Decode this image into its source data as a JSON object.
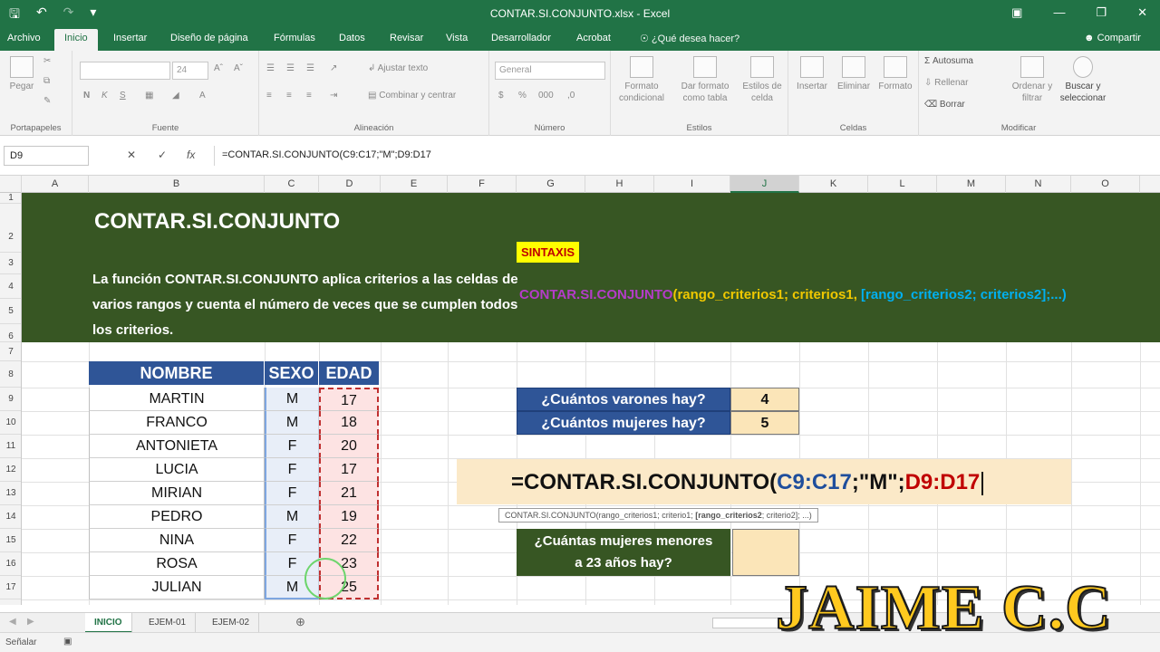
{
  "app": {
    "window_title": "CONTAR.SI.CONJUNTO.xlsx - Excel",
    "tabs": [
      "Archivo",
      "Inicio",
      "Insertar",
      "Diseño de página",
      "Fórmulas",
      "Datos",
      "Revisar",
      "Vista",
      "Desarrollador",
      "Acrobat"
    ],
    "tell_me": "¿Qué desea hacer?",
    "share": "Compartir"
  },
  "ribbon": {
    "portapapeles": {
      "paste": "Pegar",
      "label": "Portapapeles"
    },
    "fuente": {
      "font_size": "24",
      "bold": "N",
      "italic": "K",
      "underline": "S",
      "label": "Fuente"
    },
    "alineacion": {
      "wrap": "Ajustar texto",
      "merge": "Combinar y centrar",
      "label": "Alineación"
    },
    "numero": {
      "format": "General",
      "label": "Número"
    },
    "estilos": {
      "cond": "Formato condicional",
      "table": "Dar formato como tabla",
      "cell": "Estilos de celda",
      "label": "Estilos"
    },
    "celdas": {
      "insert": "Insertar",
      "delete": "Eliminar",
      "format": "Formato",
      "label": "Celdas"
    },
    "modificar": {
      "autosum": "Autosuma",
      "fill": "Rellenar",
      "clear": "Borrar",
      "sort": "Ordenar y filtrar",
      "find": "Buscar y seleccionar",
      "label": "Modificar"
    }
  },
  "formula_bar": {
    "name_box": "D9",
    "formula": "=CONTAR.SI.CONJUNTO(C9:C17;\"M\";D9:D17"
  },
  "columns": [
    "A",
    "B",
    "C",
    "D",
    "E",
    "F",
    "G",
    "H",
    "I",
    "J",
    "K",
    "L",
    "M",
    "N",
    "O"
  ],
  "rows": [
    "1",
    "2",
    "3",
    "4",
    "5",
    "6",
    "7",
    "8",
    "9",
    "10",
    "11",
    "12",
    "13",
    "14",
    "15",
    "16",
    "17"
  ],
  "sheet": {
    "title": "CONTAR.SI.CONJUNTO",
    "description": "La función CONTAR.SI.CONJUNTO aplica criterios a las celdas de varios rangos y cuenta el número de veces que se cumplen todos los criterios.",
    "sintaxis_label": "SINTAXIS",
    "syntax_fn": "CONTAR.SI.CONJUNTO",
    "syntax_required": "(rango_criterios1; criterios1, ",
    "syntax_optional": "[rango_criterios2; criterios2];...)",
    "table_headers": [
      "NOMBRE",
      "SEXO",
      "EDAD"
    ],
    "table_rows": [
      {
        "nombre": "MARTIN",
        "sexo": "M",
        "edad": "17"
      },
      {
        "nombre": "FRANCO",
        "sexo": "M",
        "edad": "18"
      },
      {
        "nombre": "ANTONIETA",
        "sexo": "F",
        "edad": "20"
      },
      {
        "nombre": "LUCIA",
        "sexo": "F",
        "edad": "17"
      },
      {
        "nombre": "MIRIAN",
        "sexo": "F",
        "edad": "21"
      },
      {
        "nombre": "PEDRO",
        "sexo": "M",
        "edad": "19"
      },
      {
        "nombre": "NINA",
        "sexo": "F",
        "edad": "22"
      },
      {
        "nombre": "ROSA",
        "sexo": "F",
        "edad": "23"
      },
      {
        "nombre": "JULIAN",
        "sexo": "M",
        "edad": "25"
      }
    ],
    "q1": {
      "label": "¿Cuántos varones hay?",
      "answer": "4"
    },
    "q2": {
      "label": "¿Cuántos mujeres hay?",
      "answer": "5"
    },
    "q3": {
      "line1": "¿Cuántas mujeres menores",
      "line2": "a  23 años hay?"
    },
    "edit_formula": {
      "prefix": "=CONTAR.SI.CONJUNTO(",
      "range1": "C9:C17",
      "middle": ";\"M\";",
      "range2": "D9:D17"
    },
    "tooltip": {
      "fn": "CONTAR.SI.CONJUNTO(rango_criterios1; criterio1; ",
      "bold": "[rango_criterios2",
      "rest": "; criterio2]; ...)"
    }
  },
  "sheet_tabs": [
    "INICIO",
    "EJEM-01",
    "EJEM-02"
  ],
  "status": "Señalar",
  "watermark": "JAIME C.C",
  "colors": {
    "excel_green": "#217346",
    "banner": "#375623",
    "header_blue": "#2f5597",
    "answer": "#fbe5b8",
    "syntax_fn": "#b43cc8",
    "syntax_req": "#f0c800",
    "syntax_opt": "#00b0f0"
  }
}
